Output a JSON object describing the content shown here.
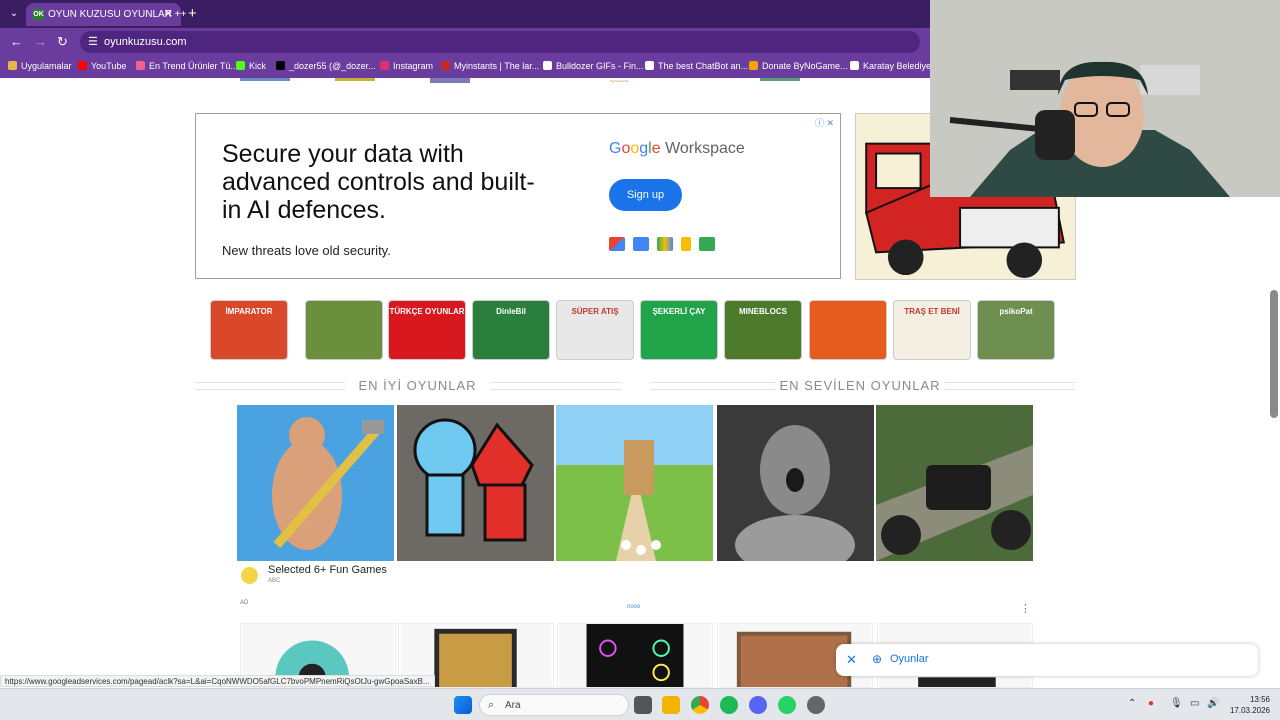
{
  "browser": {
    "tab": {
      "title": "OYUN KUZUSU OYUNLAR ++",
      "favicon": "OK",
      "close": "✕"
    },
    "newtab": "+",
    "url": "oyunkuzusu.com",
    "bookmarks": [
      {
        "label": "Uygulamalar",
        "color": "#e8b54a"
      },
      {
        "label": "YouTube",
        "color": "#ff0000"
      },
      {
        "label": "En Trend Ürünler Tü...",
        "color": "#f06292"
      },
      {
        "label": "Kick",
        "color": "#53fc18"
      },
      {
        "label": "_dozer55 (@_dozer...",
        "color": "#000000"
      },
      {
        "label": "Instagram",
        "color": "#e1306c"
      },
      {
        "label": "Myinstants | The lar...",
        "color": "#c62828"
      },
      {
        "label": "Bulldozer GIFs - Fin...",
        "color": "#ffffff"
      },
      {
        "label": "The best ChatBot an...",
        "color": "#ffffff"
      },
      {
        "label": "Donate ByNoGame...",
        "color": "#f0a500"
      },
      {
        "label": "Karatay Belediyesi",
        "color": "#ffffff"
      }
    ]
  },
  "ad": {
    "headline": "Secure your data with advanced controls and built-in AI defences.",
    "subline": "New threats love old security.",
    "brand_google": [
      "G",
      "o",
      "o",
      "g",
      "l",
      "e"
    ],
    "brand_workspace": "Workspace",
    "cta": "Sign up",
    "info_icon": "ⓘ ✕"
  },
  "categories": [
    {
      "label": "İMPARATOR",
      "color": "#d9482b"
    },
    {
      "label": "",
      "color": "#6a8f3d"
    },
    {
      "label": "TÜRKÇE OYUNLAR",
      "color": "#d7191f"
    },
    {
      "label": "DinleBil",
      "color": "#2a7f3c"
    },
    {
      "label": "SÜPER ATIŞ",
      "color": "#e8e8e8"
    },
    {
      "label": "ŞEKERLİ ÇAY",
      "color": "#21a34a"
    },
    {
      "label": "MINEBLOCS",
      "color": "#4c7a2a"
    },
    {
      "label": "",
      "color": "#e65c1f"
    },
    {
      "label": "TRAŞ ET BENİ",
      "color": "#f3efe2"
    },
    {
      "label": "psikoPat",
      "color": "#6e8f4f"
    }
  ],
  "sections": {
    "best": "EN İYİ OYUNLAR",
    "loved": "EN SEVİLEN OYUNLAR"
  },
  "games": [
    {
      "name": "getting-over-it",
      "color": "#4aa3e0"
    },
    {
      "name": "fireboy-watergirl",
      "color": "#6d6a66"
    },
    {
      "name": "bear-runner",
      "color": "#7cc04a"
    },
    {
      "name": "granny",
      "color": "#3a3a3a"
    },
    {
      "name": "car-driving",
      "color": "#4d6a3a"
    }
  ],
  "ad_footer": {
    "title": "Selected 6+ Fun Games",
    "source": "ABC",
    "label": "AD",
    "brand": "nooo",
    "kebab": "⋮"
  },
  "search_chip": {
    "close": "✕",
    "label": "Oyunlar"
  },
  "status_url": "https://www.googleadservices.com/pagead/aclk?sa=L&ai=CqoNWWDO5afGLC7bvoPMPnemRiQsOtJu-gwGpoaSaxB...",
  "taskbar": {
    "search_placeholder": "Ara",
    "time": "13:56",
    "date": "17.03.2026"
  }
}
